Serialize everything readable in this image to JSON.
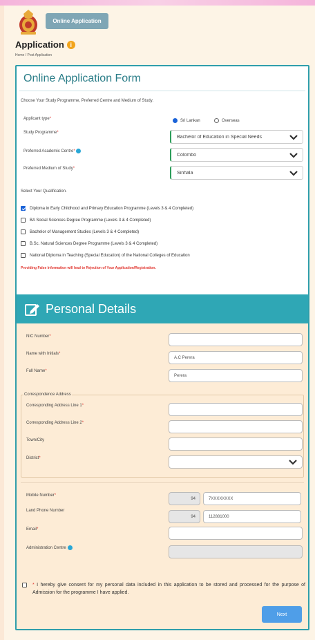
{
  "header": {
    "online_button": "Online Application",
    "page_title": "Application",
    "breadcrumb": "Home / Post Application"
  },
  "form": {
    "title": "Online Application Form",
    "instruction": "Choose Your Study Programme, Preferred Centre and Medium of Study.",
    "applicant_type": {
      "label": "Applicant type",
      "options": [
        "Sri Lankan",
        "Overseas"
      ],
      "selected": "Sri Lankan"
    },
    "study_programme": {
      "label": "Study Programme",
      "value": "Bachelor of Education in Special Needs"
    },
    "academic_centre": {
      "label": "Preferred Academic Centre",
      "value": "Colombo"
    },
    "medium": {
      "label": "Preferred Medium of Study",
      "value": "Sinhala"
    },
    "qualification_title": "Select Your Qualification.",
    "qualifications": [
      {
        "label": "Diploma in Early Childhood and Primary Education Programme (Levels 3 & 4 Completed)",
        "checked": true
      },
      {
        "label": "BA Social Sciences Degree Programme (Levels 3 & 4 Completed)",
        "checked": false
      },
      {
        "label": "Bachelor of Management Studies (Levels 3 & 4 Completed)",
        "checked": false
      },
      {
        "label": "B.Sc. Natural Sciences Degree Programme (Levels 3 & 4 Completed)",
        "checked": false
      },
      {
        "label": "National Diploma in Teaching (Special Education) of the National Colleges of Education",
        "checked": false
      }
    ],
    "warning": "Providing False Information will lead to Rejection of Your Application/Registration."
  },
  "personal": {
    "title": "Personal Details",
    "nic": {
      "label": "NIC Number",
      "value": ""
    },
    "name_initials": {
      "label": "Name with Initials",
      "value": "A.C Perera"
    },
    "full_name": {
      "label": "Full Name",
      "value": "Perera"
    },
    "address_legend": "Correspondence Address",
    "address1": {
      "label": "Corresponding Address Line 1",
      "value": ""
    },
    "address2": {
      "label": "Corresponding Address Line 2",
      "value": ""
    },
    "town": {
      "label": "Town/City",
      "value": ""
    },
    "district": {
      "label": "District",
      "value": ""
    },
    "mobile": {
      "label": "Mobile Number",
      "code": "94",
      "value": "7XXXXXXXX"
    },
    "land_phone": {
      "label": "Land Phone Number",
      "code": "94",
      "value": "112881000"
    },
    "email": {
      "label": "Email",
      "value": ""
    },
    "admin_centre": {
      "label": "Administration Centre",
      "value": ""
    },
    "consent": "I hereby give consent for my personal data included in this application to be stored and processed for the purpose of Admission for the programme I have applied.",
    "next_button": "Next"
  },
  "colors": {
    "teal": "#2fa7b5",
    "accent_blue": "#1b63d8",
    "required_red": "#e0342d"
  }
}
